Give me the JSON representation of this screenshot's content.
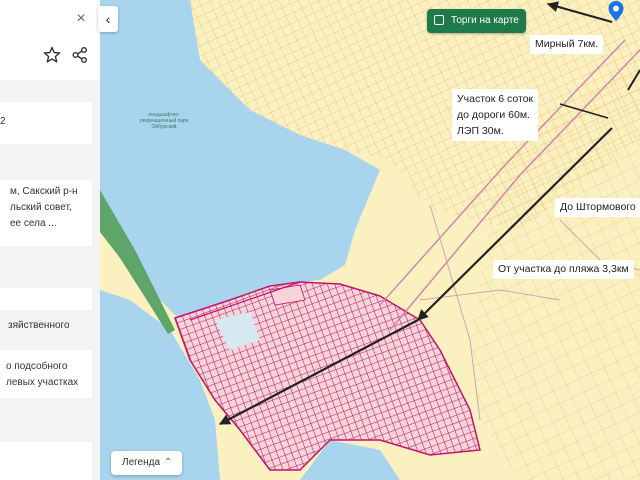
{
  "panel": {
    "close_glyph": "×",
    "favorite_icon": "star-icon",
    "share_icon": "share-icon",
    "collapse_glyph": "‹",
    "card1_text": "2",
    "card2_lines": [
      "м, Сакский р-н",
      "льский совет,",
      "ее села ..."
    ],
    "card3_text": "зяйственного",
    "card4_lines": [
      "о подсобного",
      "левых участках"
    ]
  },
  "map": {
    "torgi_button": "Торги на карте",
    "legend_button": "Легенда",
    "legend_chevron": "⌃",
    "park_label": "ландшафтно-рекреационный парк Ойбурский",
    "annotations": {
      "mirny": "Мирный 7км.",
      "plot": [
        "Участок 6 соток",
        "до дороги 60м.",
        "ЛЭП 30м."
      ],
      "shtormovoe": "До Штормового",
      "beach": "От участка до пляжа 3,3км"
    }
  }
}
